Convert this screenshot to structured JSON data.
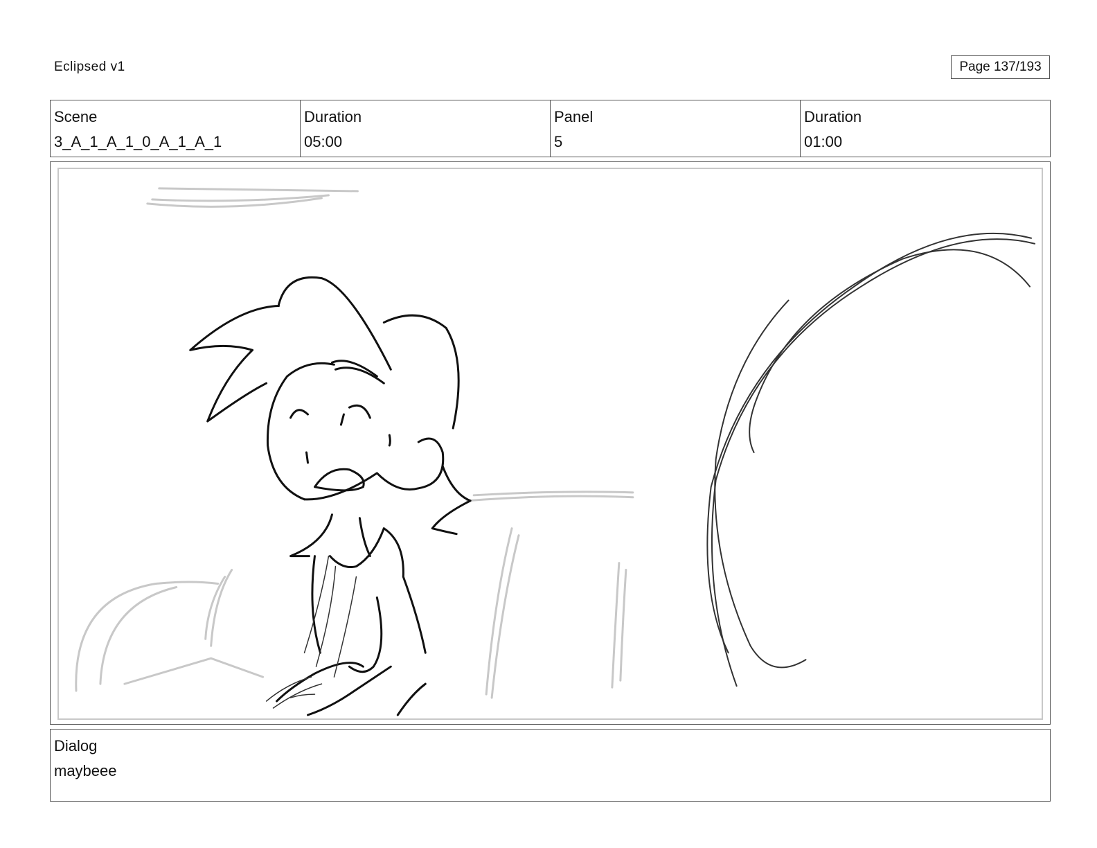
{
  "header": {
    "project_title": "Eclipsed v1",
    "page_label": "Page 137/193"
  },
  "info": {
    "scene_label": "Scene",
    "scene_value": "3_A_1_A_1_0_A_1_A_1",
    "scene_duration_label": "Duration",
    "scene_duration_value": "05:00",
    "panel_label": "Panel",
    "panel_value": "5",
    "panel_duration_label": "Duration",
    "panel_duration_value": "01:00"
  },
  "dialog": {
    "label": "Dialog",
    "text": "maybeee"
  },
  "colors": {
    "ink": "#111111",
    "sketch_gray": "#c8c8c8",
    "border": "#555555"
  }
}
